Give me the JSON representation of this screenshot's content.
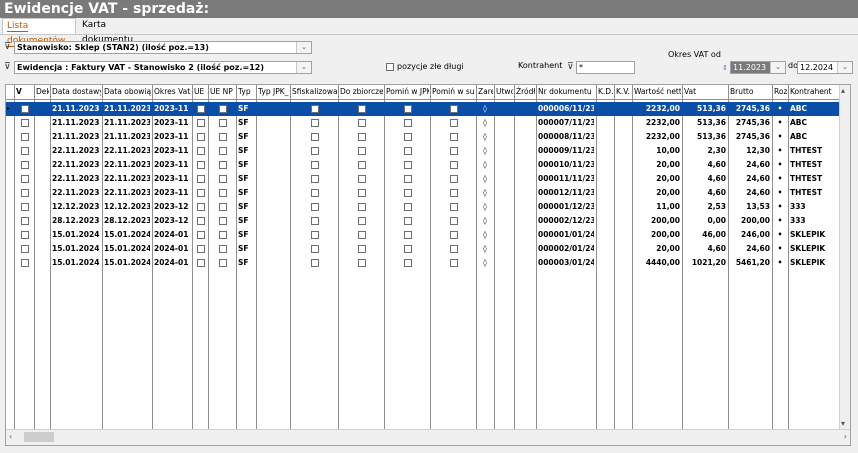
{
  "window": {
    "title": "Ewidencje VAT - sprzedaż:"
  },
  "tabs": [
    {
      "label": "Lista dokumentów"
    },
    {
      "label": "Karta dokumentu"
    }
  ],
  "filters": {
    "stanowisko": "Stanowisko: Sklep  (STAN2)  (ilość poz.=13)",
    "ewidencja": "Ewidencja : Faktury VAT - Stanowisko 2  (ilość poz.=12)",
    "pozycje_label": "pozycje złe długi",
    "kontrahent_label": "Kontrahent",
    "kontrahent_value": "*",
    "okres_label": "Okres VAT od",
    "okres_od": "11.2023",
    "do_label": "do",
    "okres_do": "12.2024"
  },
  "grid": {
    "headers": [
      "V",
      "Dek",
      "Data dostawy/u",
      "Data obowiązku",
      "Okres Vat",
      "UE",
      "UE NP",
      "Typ",
      "Typ JPK_",
      "Sfiskalizowan",
      "Do zbiorczego",
      "Pomiń w JPK",
      "Pomiń w sum",
      "Zarejes",
      "Utworz",
      "Źródło",
      "Nr dokumentu",
      "K.D.",
      "K.V.",
      "Wartość netto",
      "Vat",
      "Brutto",
      "Roz",
      "Kontrahent"
    ],
    "rows": [
      [
        "21.11.2023",
        "21.11.2023",
        "2023-11",
        "SF",
        "000006/11/23/",
        "2232,00",
        "513,36",
        "2745,36",
        "ABC"
      ],
      [
        "21.11.2023",
        "21.11.2023",
        "2023-11",
        "SF",
        "000007/11/23/",
        "2232,00",
        "513,36",
        "2745,36",
        "ABC"
      ],
      [
        "21.11.2023",
        "21.11.2023",
        "2023-11",
        "SF",
        "000008/11/23/",
        "2232,00",
        "513,36",
        "2745,36",
        "ABC"
      ],
      [
        "22.11.2023",
        "22.11.2023",
        "2023-11",
        "SF",
        "000009/11/23/",
        "10,00",
        "2,30",
        "12,30",
        "THTEST"
      ],
      [
        "22.11.2023",
        "22.11.2023",
        "2023-11",
        "SF",
        "000010/11/23/",
        "20,00",
        "4,60",
        "24,60",
        "THTEST"
      ],
      [
        "22.11.2023",
        "22.11.2023",
        "2023-11",
        "SF",
        "000011/11/23/",
        "20,00",
        "4,60",
        "24,60",
        "THTEST"
      ],
      [
        "22.11.2023",
        "22.11.2023",
        "2023-11",
        "SF",
        "000012/11/23/",
        "20,00",
        "4,60",
        "24,60",
        "THTEST"
      ],
      [
        "12.12.2023",
        "12.12.2023",
        "2023-12",
        "SF",
        "000001/12/23/",
        "11,00",
        "2,53",
        "13,53",
        "333"
      ],
      [
        "28.12.2023",
        "28.12.2023",
        "2023-12",
        "SF",
        "000002/12/23/",
        "200,00",
        "0,00",
        "200,00",
        "333"
      ],
      [
        "15.01.2024",
        "15.01.2024",
        "2024-01",
        "SF",
        "000001/01/24/",
        "200,00",
        "46,00",
        "246,00",
        "SKLEPIK"
      ],
      [
        "15.01.2024",
        "15.01.2024",
        "2024-01",
        "SF",
        "000002/01/24/",
        "20,00",
        "4,60",
        "24,60",
        "SKLEPIK"
      ],
      [
        "15.01.2024",
        "15.01.2024",
        "2024-01",
        "SF",
        "000003/01/24/",
        "4440,00",
        "1021,20",
        "5461,20",
        "SKLEPIK"
      ]
    ],
    "zarejestrowano_mark": "◊",
    "roz_mark": "•",
    "selected_row": 0
  }
}
